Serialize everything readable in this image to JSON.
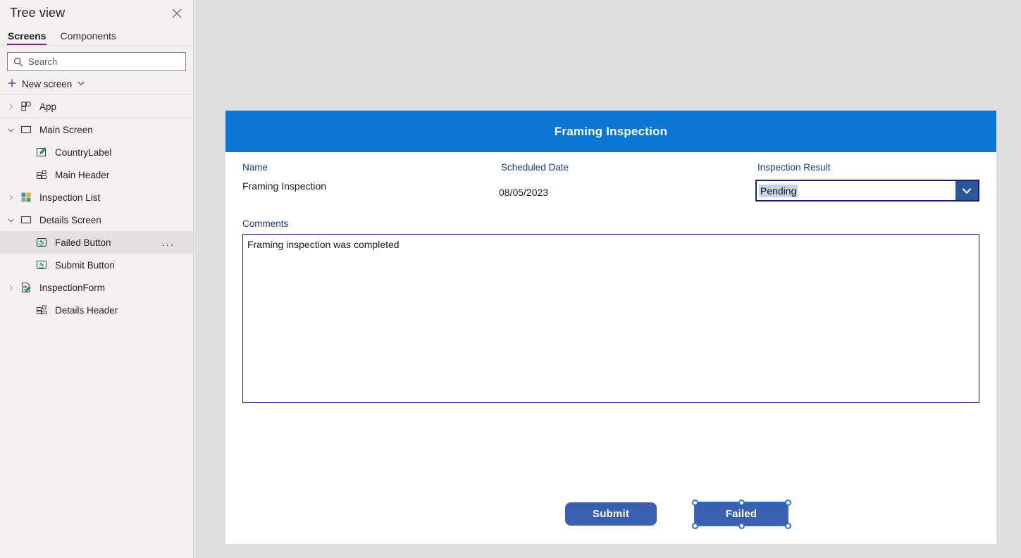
{
  "sidebar": {
    "title": "Tree view",
    "close_icon": "close-icon",
    "tabs": [
      {
        "label": "Screens",
        "active": true
      },
      {
        "label": "Components",
        "active": false
      }
    ],
    "search": {
      "placeholder": "Search",
      "value": "",
      "icon": "search-icon"
    },
    "new_screen": {
      "label": "New screen",
      "plus_icon": "plus-icon",
      "chevron_icon": "chevron-down-icon"
    },
    "tree": [
      {
        "label": "App",
        "icon": "app-grid-icon",
        "indent": 0,
        "chevron": "right",
        "selected": false
      },
      {
        "label": "Main Screen",
        "icon": "screen-icon",
        "indent": 0,
        "chevron": "down",
        "selected": false
      },
      {
        "label": "CountryLabel",
        "icon": "label-pencil-icon",
        "indent": 2,
        "chevron": "none",
        "selected": false
      },
      {
        "label": "Main Header",
        "icon": "header-grid-icon",
        "indent": 2,
        "chevron": "none",
        "selected": false
      },
      {
        "label": "Inspection List",
        "icon": "gallery-color-icon",
        "indent": 1,
        "chevron": "right",
        "selected": false
      },
      {
        "label": "Details Screen",
        "icon": "screen-icon",
        "indent": 0,
        "chevron": "down",
        "selected": false
      },
      {
        "label": "Failed Button",
        "icon": "button-hand-icon",
        "indent": 2,
        "chevron": "none",
        "selected": true,
        "overflow": "..."
      },
      {
        "label": "Submit Button",
        "icon": "button-hand-icon",
        "indent": 2,
        "chevron": "none",
        "selected": false
      },
      {
        "label": "InspectionForm",
        "icon": "form-pencil-icon",
        "indent": 1,
        "chevron": "right",
        "selected": false
      },
      {
        "label": "Details Header",
        "icon": "header-grid-icon",
        "indent": 2,
        "chevron": "none",
        "selected": false
      }
    ]
  },
  "canvas": {
    "header_title": "Framing Inspection",
    "fields": {
      "name": {
        "label": "Name",
        "value": "Framing Inspection"
      },
      "scheduled_date": {
        "label": "Scheduled Date",
        "value": "08/05/2023"
      },
      "inspection_result": {
        "label": "Inspection Result",
        "value": "Pending",
        "chevron_icon": "chevron-down-icon"
      },
      "comments": {
        "label": "Comments",
        "value": "Framing inspection was completed"
      }
    },
    "buttons": [
      {
        "label": "Submit",
        "selected": false
      },
      {
        "label": "Failed",
        "selected": true
      }
    ]
  },
  "colors": {
    "header_blue": "#0A77D5",
    "button_blue": "#3B5FB0",
    "label_navy": "#1F3C88",
    "accent_purple": "#742774",
    "selection_blue": "#2F6FD0",
    "dropdown_button": "#2B579A",
    "text_highlight": "#C6D4E8"
  }
}
